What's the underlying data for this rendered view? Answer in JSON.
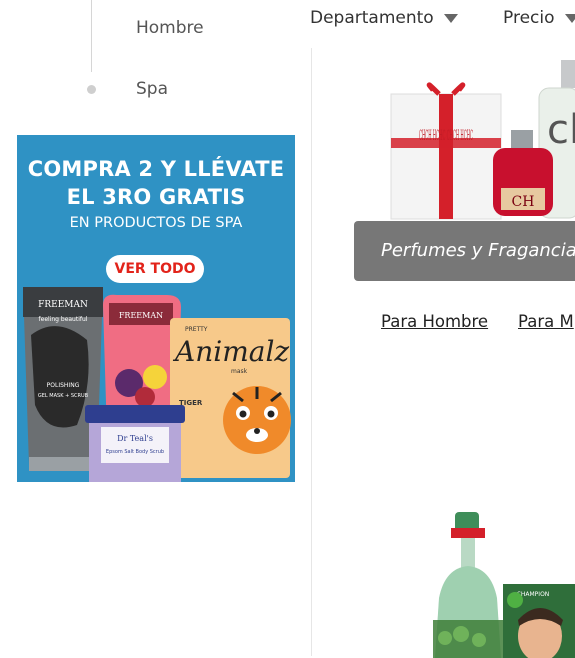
{
  "sidebar": {
    "categories": [
      {
        "label": "Hombre"
      },
      {
        "label": "Spa"
      }
    ],
    "promo": {
      "headline_line1": "COMPRA 2 Y LLÉVATE",
      "headline_line2": "EL 3RO GRATIS",
      "subline": "EN PRODUCTOS DE SPA",
      "button_label": "VER TODO",
      "product_texts": {
        "brand": "FREEMAN",
        "brand_sub": "feeling beautiful",
        "charcoal_label": "POLISHING",
        "charcoal_desc": "GEL MASK + SCRUB",
        "animalz": "Animalz",
        "animalz_pre": "PRETTY",
        "animalz_post": "mask",
        "tiger": "TIGER",
        "jar_brand": "Dr Teal's",
        "jar_desc": "Epsom Salt Body Scrub"
      },
      "colors": {
        "background": "#2f92c4",
        "button_text": "#e2231a"
      }
    }
  },
  "filters": [
    {
      "label": "Departamento"
    },
    {
      "label": "Precio"
    }
  ],
  "category_card": {
    "title": "Perfumes y Fragancias",
    "box_text": "CHCH HCHC CHCH HCHC",
    "bottle_text": "CH",
    "bottle2_text": "cl"
  },
  "sublinks": [
    {
      "label": "Para Hombre"
    },
    {
      "label": "Para M"
    }
  ],
  "second_card": {
    "box_label": "CHAMPION"
  }
}
